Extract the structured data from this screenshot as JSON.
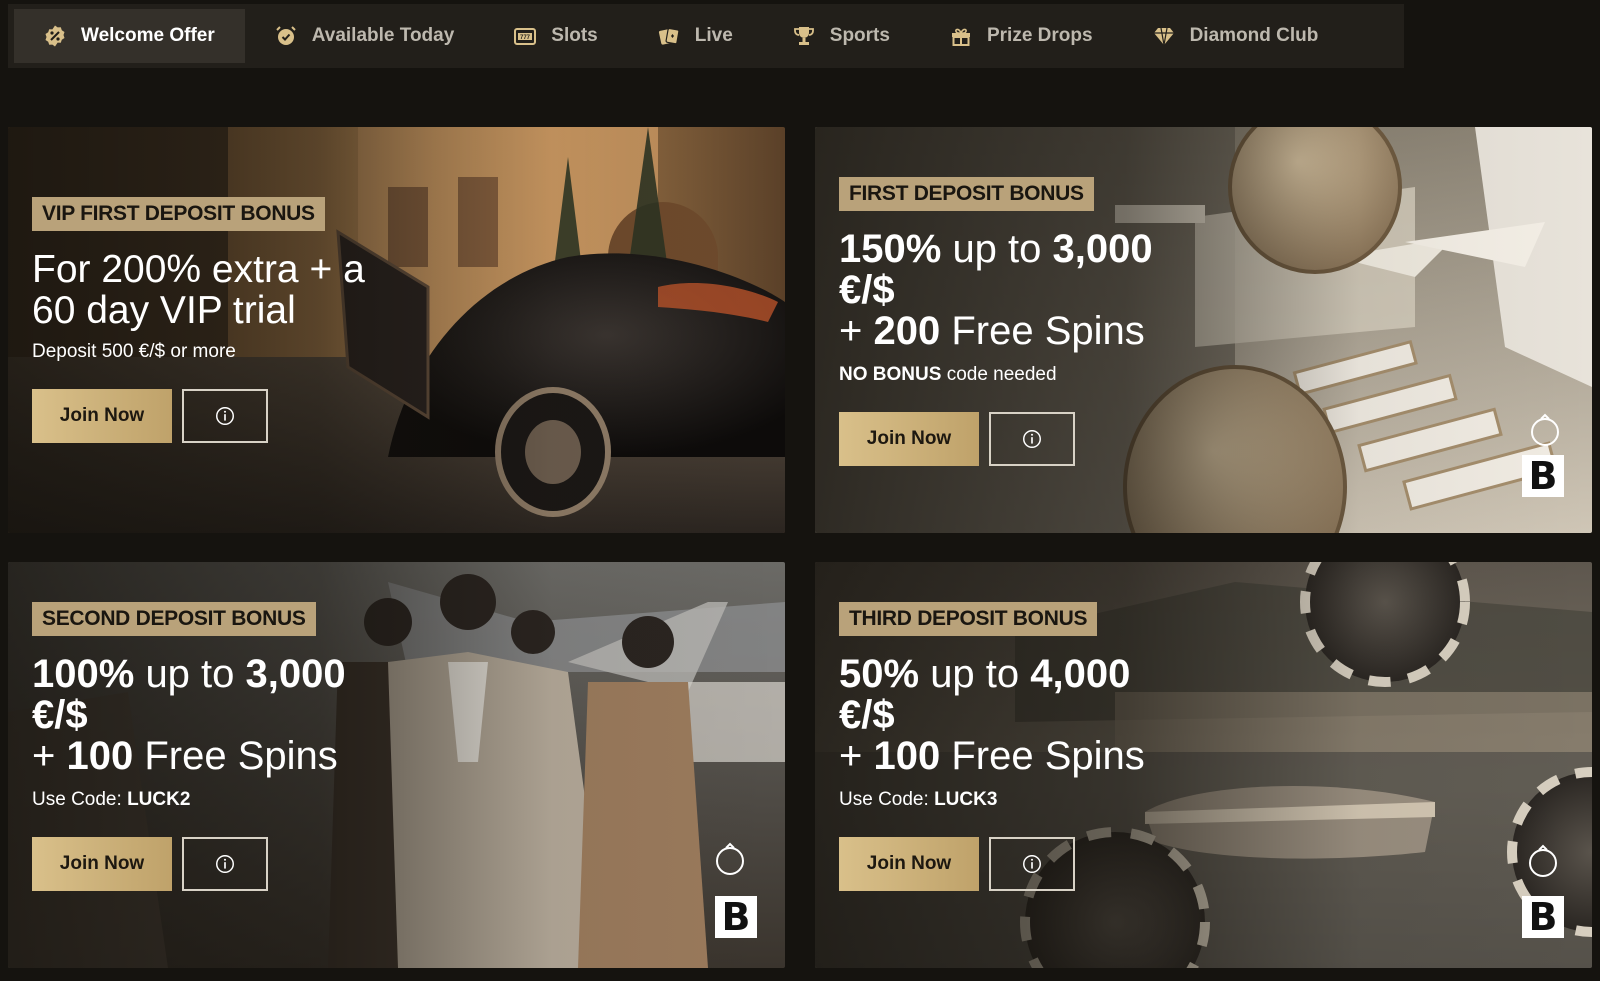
{
  "nav": {
    "tabs": [
      {
        "label": "Welcome Offer",
        "icon": "percent-badge-icon",
        "active": true
      },
      {
        "label": "Available Today",
        "icon": "alarm-clock-icon",
        "active": false
      },
      {
        "label": "Slots",
        "icon": "slot-machine-icon",
        "active": false
      },
      {
        "label": "Live",
        "icon": "playing-cards-icon",
        "active": false
      },
      {
        "label": "Sports",
        "icon": "trophy-icon",
        "active": false
      },
      {
        "label": "Prize Drops",
        "icon": "gift-icon",
        "active": false
      },
      {
        "label": "Diamond Club",
        "icon": "diamond-icon",
        "active": false
      }
    ]
  },
  "cards": [
    {
      "badge": "VIP FIRST DEPOSIT BONUS",
      "headline_line1": "For 200% extra + a",
      "headline_line2": "60 day VIP trial",
      "sub": "Deposit 500 €/$ or more",
      "join_label": "Join Now",
      "info_icon": "info-icon"
    },
    {
      "badge": "FIRST DEPOSIT BONUS",
      "pct": "150%",
      "up_to": "up to",
      "amount": "3,000",
      "currency": "€/$",
      "plus": "+",
      "spins_count": "200",
      "spins_label": "Free Spins",
      "sub_bold": "NO BONUS",
      "sub_rest": "code needed",
      "join_label": "Join Now",
      "brand_letter": "B"
    },
    {
      "badge": "SECOND DEPOSIT BONUS",
      "pct": "100%",
      "up_to": "up to",
      "amount": "3,000",
      "currency": "€/$",
      "plus": "+",
      "spins_count": "100",
      "spins_label": "Free Spins",
      "sub_rest": "Use Code:",
      "sub_bold": "LUCK2",
      "join_label": "Join Now",
      "brand_letter": "B"
    },
    {
      "badge": "THIRD DEPOSIT BONUS",
      "pct": "50%",
      "up_to": "up to",
      "amount": "4,000",
      "currency": "€/$",
      "plus": "+",
      "spins_count": "100",
      "spins_label": "Free Spins",
      "sub_rest": "Use Code:",
      "sub_bold": "LUCK3",
      "join_label": "Join Now",
      "brand_letter": "B"
    }
  ],
  "colors": {
    "page_bg": "#15130f",
    "nav_bg": "#221f1a",
    "active_tab_bg": "#34302a",
    "badge_bg": "#b9a27a",
    "button_gold": "#d9c08a"
  }
}
